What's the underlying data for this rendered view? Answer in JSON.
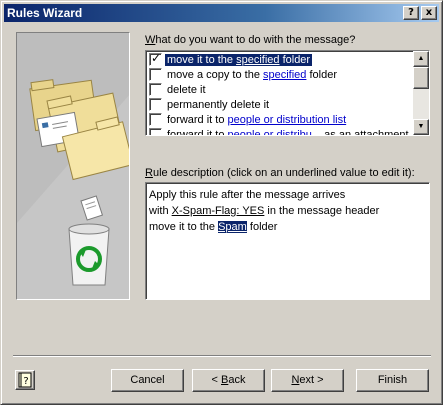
{
  "window": {
    "title": "Rules Wizard",
    "help_glyph": "?",
    "close_glyph": "x"
  },
  "actions": {
    "label_prefix": "",
    "label_underlined": "W",
    "label_rest": "hat do you want to do with the message?",
    "items": [
      {
        "checked": true,
        "selected": true,
        "text_before": "move it to the ",
        "link": "specified",
        "text_after": " folder"
      },
      {
        "checked": false,
        "selected": false,
        "text_before": "move a copy to the ",
        "link": "specified",
        "text_after": " folder"
      },
      {
        "checked": false,
        "selected": false,
        "text_before": "delete it",
        "link": "",
        "text_after": ""
      },
      {
        "checked": false,
        "selected": false,
        "text_before": "permanently delete it",
        "link": "",
        "text_after": ""
      },
      {
        "checked": false,
        "selected": false,
        "text_before": "forward it to ",
        "link": "people or distribution list",
        "text_after": ""
      },
      {
        "checked": false,
        "selected": false,
        "text_before": "forward it to ",
        "link": "people or distribu...",
        "text_after": " as an attachment"
      }
    ],
    "check_mark": "✓",
    "scroll_up": "▲",
    "scroll_down": "▼"
  },
  "description": {
    "label_underlined": "R",
    "label_rest": "ule description (click on an underlined value to edit it):",
    "line1": "Apply this rule after the message arrives",
    "line2_before": "with ",
    "line2_link": "X-Spam-Flag: YES",
    "line2_after": " in the message header",
    "line3_before": "move it to the ",
    "line3_link": "Spam",
    "line3_after": " folder"
  },
  "buttons": {
    "cancel": "Cancel",
    "back_prefix": "< ",
    "back_u": "B",
    "back_rest": "ack",
    "next_u": "N",
    "next_rest": "ext >",
    "finish": "Finish"
  },
  "icons": {
    "help": "help-book-icon",
    "art": "rules-folders-recycle-illustration"
  }
}
